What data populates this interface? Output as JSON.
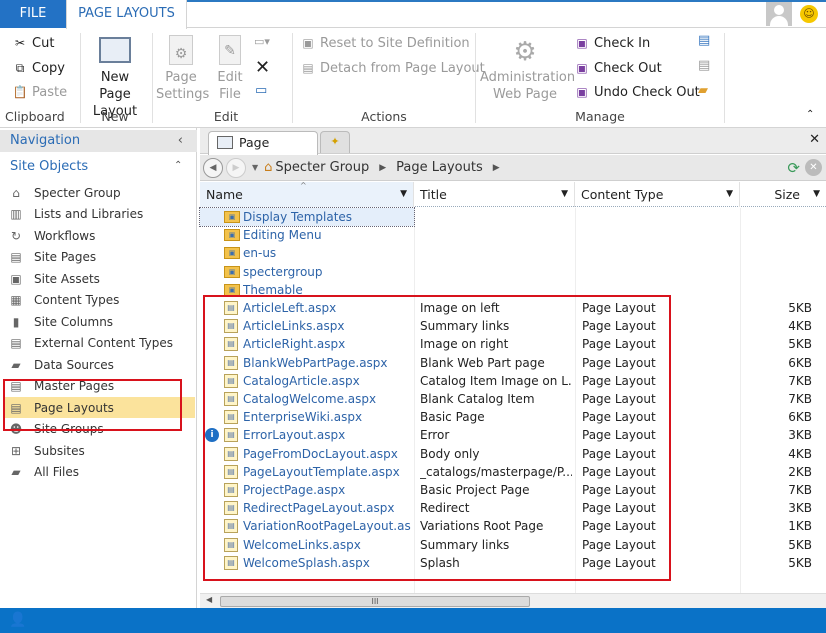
{
  "tabs": {
    "file": "FILE",
    "active": "PAGE LAYOUTS"
  },
  "ribbon": {
    "clipboard": {
      "cut": "Cut",
      "copy": "Copy",
      "paste": "Paste",
      "group": "Clipboard"
    },
    "new": {
      "new_page_layout_1": "New Page",
      "new_page_layout_2": "Layout",
      "group": "New"
    },
    "edit": {
      "page_settings_1": "Page",
      "page_settings_2": "Settings",
      "edit_file_1": "Edit",
      "edit_file_2": "File",
      "group": "Edit"
    },
    "actions": {
      "reset": "Reset to Site Definition",
      "detach": "Detach from Page Layout",
      "group": "Actions"
    },
    "manage": {
      "admin_1": "Administration",
      "admin_2": "Web Page",
      "check_in": "Check In",
      "check_out": "Check Out",
      "undo_check_out": "Undo Check Out",
      "group": "Manage"
    }
  },
  "nav": {
    "title": "Navigation",
    "section": "Site Objects",
    "items": [
      {
        "label": "Specter Group",
        "icon": "home-icon"
      },
      {
        "label": "Lists and Libraries",
        "icon": "list-icon"
      },
      {
        "label": "Workflows",
        "icon": "workflow-icon"
      },
      {
        "label": "Site Pages",
        "icon": "pages-icon"
      },
      {
        "label": "Site Assets",
        "icon": "assets-icon"
      },
      {
        "label": "Content Types",
        "icon": "content-types-icon"
      },
      {
        "label": "Site Columns",
        "icon": "columns-icon"
      },
      {
        "label": "External Content Types",
        "icon": "external-icon"
      },
      {
        "label": "Data Sources",
        "icon": "database-icon"
      },
      {
        "label": "Master Pages",
        "icon": "master-page-icon"
      },
      {
        "label": "Page Layouts",
        "icon": "page-layout-icon",
        "selected": true
      },
      {
        "label": "Site Groups",
        "icon": "groups-icon"
      },
      {
        "label": "Subsites",
        "icon": "subsites-icon"
      },
      {
        "label": "All Files",
        "icon": "folder-icon"
      }
    ]
  },
  "doc_tab": "Page Layouts",
  "breadcrumb": [
    "Specter Group",
    "Page Layouts"
  ],
  "columns": {
    "name": "Name",
    "title": "Title",
    "content_type": "Content Type",
    "size": "Size"
  },
  "folders": [
    "Display Templates",
    "Editing Menu",
    "en-us",
    "spectergroup",
    "Themable"
  ],
  "files": [
    {
      "name": "ArticleLeft.aspx",
      "title": "Image on left",
      "type": "Page Layout",
      "size": "5KB"
    },
    {
      "name": "ArticleLinks.aspx",
      "title": "Summary links",
      "type": "Page Layout",
      "size": "4KB"
    },
    {
      "name": "ArticleRight.aspx",
      "title": "Image on right",
      "type": "Page Layout",
      "size": "5KB"
    },
    {
      "name": "BlankWebPartPage.aspx",
      "title": "Blank Web Part page",
      "type": "Page Layout",
      "size": "6KB"
    },
    {
      "name": "CatalogArticle.aspx",
      "title": "Catalog Item Image on L...",
      "type": "Page Layout",
      "size": "7KB"
    },
    {
      "name": "CatalogWelcome.aspx",
      "title": "Blank Catalog Item",
      "type": "Page Layout",
      "size": "7KB"
    },
    {
      "name": "EnterpriseWiki.aspx",
      "title": "Basic Page",
      "type": "Page Layout",
      "size": "6KB"
    },
    {
      "name": "ErrorLayout.aspx",
      "title": "Error",
      "type": "Page Layout",
      "size": "3KB",
      "info": true
    },
    {
      "name": "PageFromDocLayout.aspx",
      "title": "Body only",
      "type": "Page Layout",
      "size": "4KB"
    },
    {
      "name": "PageLayoutTemplate.aspx",
      "title": "_catalogs/masterpage/P...",
      "type": "Page Layout",
      "size": "2KB"
    },
    {
      "name": "ProjectPage.aspx",
      "title": "Basic Project Page",
      "type": "Page Layout",
      "size": "7KB"
    },
    {
      "name": "RedirectPageLayout.aspx",
      "title": "Redirect",
      "type": "Page Layout",
      "size": "3KB"
    },
    {
      "name": "VariationRootPageLayout.as...",
      "title": "Variations Root Page",
      "type": "Page Layout",
      "size": "1KB"
    },
    {
      "name": "WelcomeLinks.aspx",
      "title": "Summary links",
      "type": "Page Layout",
      "size": "5KB"
    },
    {
      "name": "WelcomeSplash.aspx",
      "title": "Splash",
      "type": "Page Layout",
      "size": "5KB"
    }
  ],
  "colors": {
    "accent": "#2372c5",
    "highlight": "#fbe39c",
    "annotation": "#d8121c"
  }
}
